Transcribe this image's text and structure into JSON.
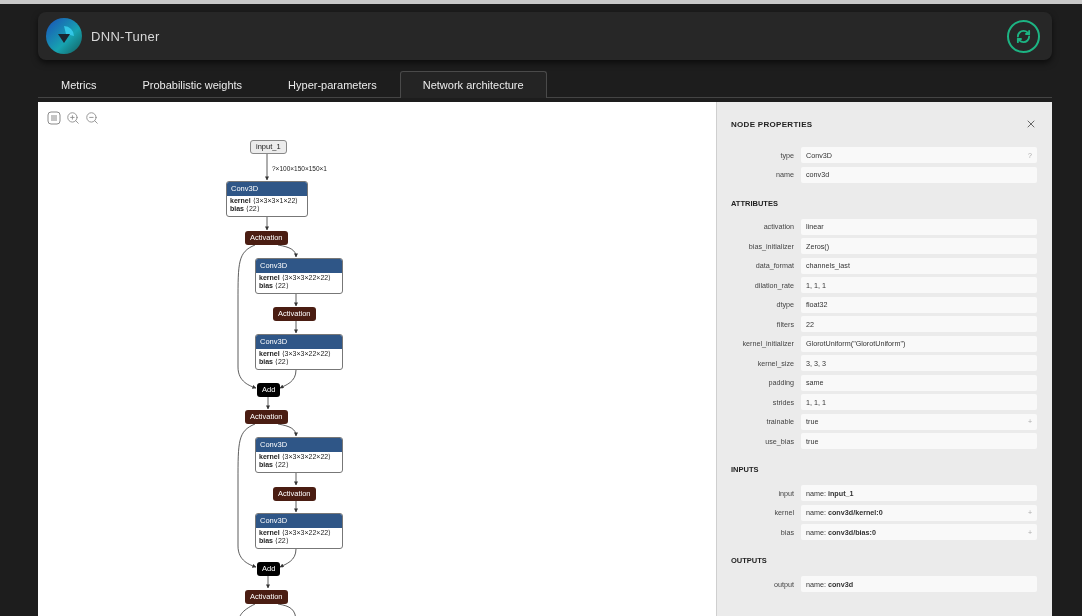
{
  "header": {
    "title": "DNN-Tuner"
  },
  "tabs": [
    {
      "label": "Metrics",
      "selected": false
    },
    {
      "label": "Probabilistic weights",
      "selected": false
    },
    {
      "label": "Hyper-parameters",
      "selected": false
    },
    {
      "label": "Network architecture",
      "selected": true
    }
  ],
  "graph": {
    "nodes": [
      {
        "kind": "input",
        "label": "input_1",
        "output_shape": "?×100×150×150×1"
      },
      {
        "kind": "conv",
        "label": "Conv3D",
        "attributes": [
          "**kernel** ⟨3×3×3×1×22⟩",
          "**bias** ⟨22⟩"
        ]
      },
      {
        "kind": "activation",
        "label": "Activation"
      },
      {
        "kind": "conv",
        "label": "Conv3D",
        "attributes": [
          "**kernel** ⟨3×3×3×22×22⟩",
          "**bias** ⟨22⟩"
        ]
      },
      {
        "kind": "activation",
        "label": "Activation"
      },
      {
        "kind": "conv",
        "label": "Conv3D",
        "attributes": [
          "**kernel** ⟨3×3×3×22×22⟩",
          "**bias** ⟨22⟩"
        ]
      },
      {
        "kind": "add",
        "label": "Add"
      },
      {
        "kind": "activation",
        "label": "Activation"
      },
      {
        "kind": "conv",
        "label": "Conv3D",
        "attributes": [
          "**kernel** ⟨3×3×3×22×22⟩",
          "**bias** ⟨22⟩"
        ]
      },
      {
        "kind": "activation",
        "label": "Activation"
      },
      {
        "kind": "conv",
        "label": "Conv3D",
        "attributes": [
          "**kernel** ⟨3×3×3×22×22⟩",
          "**bias** ⟨22⟩"
        ]
      },
      {
        "kind": "add",
        "label": "Add"
      },
      {
        "kind": "activation",
        "label": "Activation"
      }
    ]
  },
  "panel": {
    "title": "NODE PROPERTIES",
    "sections": [
      {
        "rows": [
          {
            "label": "type",
            "value": "Conv3D",
            "button": "?"
          },
          {
            "label": "name",
            "value": "conv3d"
          }
        ]
      },
      {
        "heading": "ATTRIBUTES",
        "rows": [
          {
            "label": "activation",
            "value": "linear"
          },
          {
            "label": "bias_initializer",
            "value": "Zeros()"
          },
          {
            "label": "data_format",
            "value": "channels_last"
          },
          {
            "label": "dilation_rate",
            "value": "1, 1, 1"
          },
          {
            "label": "dtype",
            "value": "float32"
          },
          {
            "label": "filters",
            "value": "22"
          },
          {
            "label": "kernel_initializer",
            "value": "GlorotUniform(\"GlorotUniform\")"
          },
          {
            "label": "kernel_size",
            "value": "3, 3, 3"
          },
          {
            "label": "padding",
            "value": "same"
          },
          {
            "label": "strides",
            "value": "1, 1, 1"
          },
          {
            "label": "trainable",
            "value": "true",
            "button": "+"
          },
          {
            "label": "use_bias",
            "value": "true"
          }
        ]
      },
      {
        "heading": "INPUTS",
        "rows": [
          {
            "label": "input",
            "value": "name: **input_1**"
          },
          {
            "label": "kernel",
            "value": "name: **conv3d/kernel:0**",
            "button": "+"
          },
          {
            "label": "bias",
            "value": "name: **conv3d/bias:0**",
            "button": "+"
          }
        ]
      },
      {
        "heading": "OUTPUTS",
        "rows": [
          {
            "label": "output",
            "value": "name: **conv3d**"
          }
        ]
      }
    ]
  }
}
